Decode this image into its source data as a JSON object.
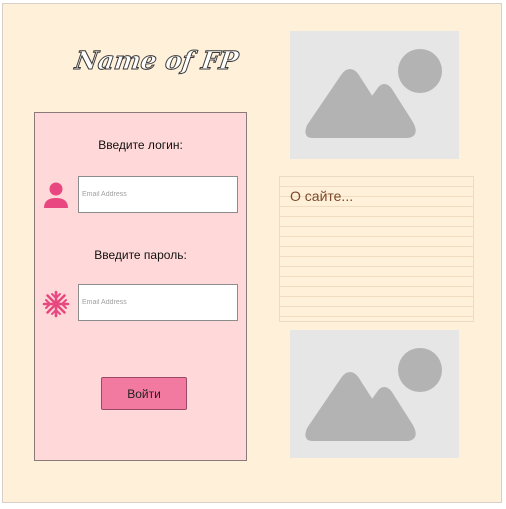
{
  "header": {
    "logo_text": "Name of FP"
  },
  "login": {
    "login_label": "Введите логин:",
    "login_placeholder": "Email Address",
    "password_label": "Введите пароль:",
    "password_placeholder": "Email Address",
    "submit_label": "Войти"
  },
  "about": {
    "title": "О сайте..."
  },
  "colors": {
    "page_bg": "#fff0d9",
    "panel_bg": "#ffd9d9",
    "accent": "#e84780",
    "button": "#f279a0",
    "placeholder_bg": "#e6e6e6",
    "placeholder_icon": "#b3b3b3"
  },
  "icons": {
    "login_icon": "user-icon",
    "password_icon": "asterisk-icon",
    "image_placeholder_icon": "image-icon"
  }
}
